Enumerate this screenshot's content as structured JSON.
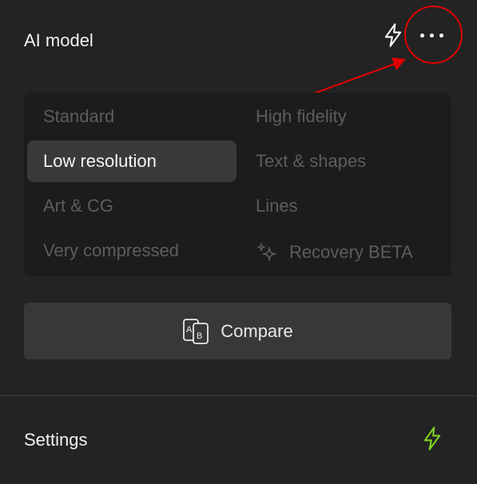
{
  "ai_model": {
    "title": "AI model",
    "header_icons": [
      "bolt-icon",
      "more-horizontal-icon"
    ]
  },
  "models": {
    "options": [
      {
        "label": "Standard",
        "selected": false
      },
      {
        "label": "High fidelity",
        "selected": false
      },
      {
        "label": "Low resolution",
        "selected": true
      },
      {
        "label": "Text & shapes",
        "selected": false
      },
      {
        "label": "Art & CG",
        "selected": false
      },
      {
        "label": "Lines",
        "selected": false
      },
      {
        "label": "Very compressed",
        "selected": false
      },
      {
        "label": "Recovery BETA",
        "selected": false,
        "icon": "sparkle-icon"
      }
    ]
  },
  "compare": {
    "label": "Compare",
    "icon": "compare-ab-icon"
  },
  "settings": {
    "title": "Settings",
    "icon": "bolt-icon",
    "icon_color": "#7ed321"
  },
  "colors": {
    "background": "#232323",
    "grid_background": "#1c1c1c",
    "selected_background": "#3a3a3a",
    "disabled_text": "#5d5d5d",
    "annotation": "#e00000"
  }
}
